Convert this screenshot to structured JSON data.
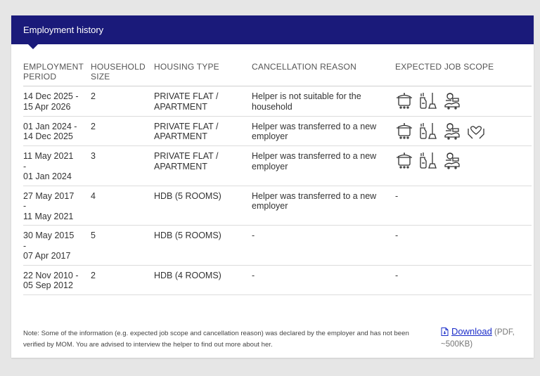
{
  "header": {
    "title": "Employment history"
  },
  "table": {
    "columns": [
      "EMPLOYMENT PERIOD",
      "HOUSEHOLD SIZE",
      "HOUSING TYPE",
      "CANCELLATION REASON",
      "EXPECTED JOB SCOPE"
    ],
    "rows": [
      {
        "period_start": "14 Dec 2025 -",
        "period_end": "15 Apr 2026",
        "size": "2",
        "housing": "PRIVATE FLAT / APARTMENT",
        "reason": "Helper is not suitable for the household",
        "scope": [
          "cooking-icon",
          "cleaning-icon",
          "child-care-icon"
        ]
      },
      {
        "period_start": "01 Jan 2024 -",
        "period_end": "14 Dec 2025",
        "size": "2",
        "housing": "PRIVATE FLAT / APARTMENT",
        "reason": "Helper was transferred to a new employer",
        "scope": [
          "cooking-icon",
          "cleaning-icon",
          "child-care-icon",
          "caregiving-icon"
        ]
      },
      {
        "period_start": "11 May 2021",
        "period_dash": "-",
        "period_end": "01 Jan 2024",
        "size": "3",
        "housing": "PRIVATE FLAT / APARTMENT",
        "reason": "Helper was transferred to a new employer",
        "scope": [
          "cooking-icon",
          "cleaning-icon",
          "child-care-icon"
        ]
      },
      {
        "period_start": "27 May 2017",
        "period_dash": "-",
        "period_end": "11 May 2021",
        "size": "4",
        "housing": "HDB (5 ROOMS)",
        "reason": "Helper was transferred to a new employer",
        "scope_text": "-"
      },
      {
        "period_start": "30 May 2015",
        "period_dash": "-",
        "period_end": "07 Apr 2017",
        "size": "5",
        "housing": "HDB (5 ROOMS)",
        "reason": "-",
        "scope_text": "-"
      },
      {
        "period_start": "22 Nov 2010 -",
        "period_end": "05 Sep 2012",
        "size": "2",
        "housing": "HDB (4 ROOMS)",
        "reason": "-",
        "scope_text": "-"
      }
    ]
  },
  "footer": {
    "note": "Note: Some of the information (e.g. expected job scope and cancellation reason) was declared by the employer and has not been verified by MOM. You are advised to interview the helper to find out more about her.",
    "download_label": "Download",
    "download_meta": "(PDF, ~500KB)"
  },
  "colors": {
    "header_bg": "#1a1a7a",
    "link": "#1a2cc9"
  }
}
